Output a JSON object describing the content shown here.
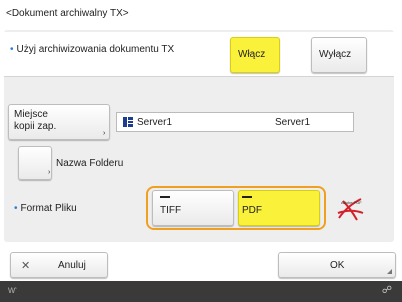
{
  "title": "<Dokument archiwalny TX>",
  "archive": {
    "label": "Użyj archiwizowania dokumentu TX",
    "on_label": "Włącz",
    "off_label": "Wyłącz",
    "selected": "on"
  },
  "storage": {
    "button_label_line1": "Miejsce",
    "button_label_line2": "kopii zap.",
    "server_name": "Server1",
    "server_value": "Server1"
  },
  "folder": {
    "label": "Nazwa Folderu"
  },
  "format": {
    "label": "Format Pliku",
    "tiff_label": "TIFF",
    "pdf_label": "PDF",
    "selected": "pdf",
    "logo_caption": "Adobe PDF"
  },
  "actions": {
    "cancel_label": "Anuluj",
    "ok_label": "OK"
  },
  "colors": {
    "selected": "#f9f13a",
    "accent": "#2a7bd8",
    "highlight": "#f0a020",
    "logo": "#d4202a"
  },
  "icons": [
    "server-icon",
    "close-icon",
    "resize-icon",
    "adobe-pdf-logo"
  ]
}
